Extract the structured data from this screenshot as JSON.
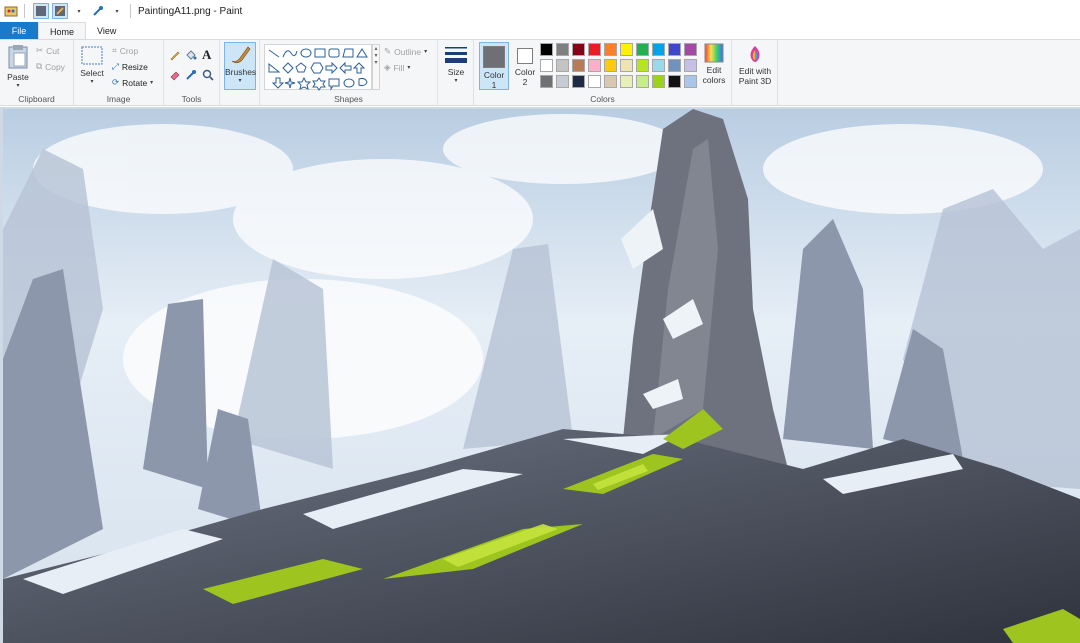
{
  "window": {
    "title": "PaintingA11.png - Paint"
  },
  "tabs": {
    "file": "File",
    "home": "Home",
    "view": "View"
  },
  "clipboard": {
    "label": "Clipboard",
    "paste": "Paste",
    "cut": "Cut",
    "copy": "Copy"
  },
  "image": {
    "label": "Image",
    "select": "Select",
    "crop": "Crop",
    "resize": "Resize",
    "rotate": "Rotate"
  },
  "tools": {
    "label": "Tools"
  },
  "brushes": {
    "label": "Brushes"
  },
  "shapes": {
    "label": "Shapes",
    "outline": "Outline",
    "fill": "Fill"
  },
  "size": {
    "label": "Size"
  },
  "colors": {
    "label": "Colors",
    "color1": "Color 1",
    "color1_line1": "Color",
    "color1_line2": "1",
    "color2_line1": "Color",
    "color2_line2": "2",
    "color1_value": "#6f6f76",
    "color2_value": "#ffffff",
    "edit_line1": "Edit",
    "edit_line2": "colors",
    "palette": [
      "#000000",
      "#7f7f7f",
      "#880015",
      "#ed1c24",
      "#ff7f27",
      "#fff200",
      "#22b14c",
      "#00a2e8",
      "#3f48cc",
      "#a349a4",
      "#ffffff",
      "#c3c3c3",
      "#b97a57",
      "#ffaec9",
      "#ffc90e",
      "#efe4b0",
      "#b5e61d",
      "#99d9ea",
      "#7092be",
      "#c8bfe7",
      "#6f6f76",
      "#c5ccd6",
      "#1f2a44",
      "#ffffff",
      "#d8c8b0",
      "#e8f0b8",
      "#c6ee88",
      "#9dd21b",
      "#121212",
      "#a9c5ea"
    ]
  },
  "paint3d": {
    "line1": "Edit with",
    "line2": "Paint 3D"
  },
  "canvas": {
    "palette": {
      "sky": "#dbe8f3",
      "rock": "#6e727e",
      "grass": "#9dc41f",
      "snow": "#eef3f8"
    }
  }
}
